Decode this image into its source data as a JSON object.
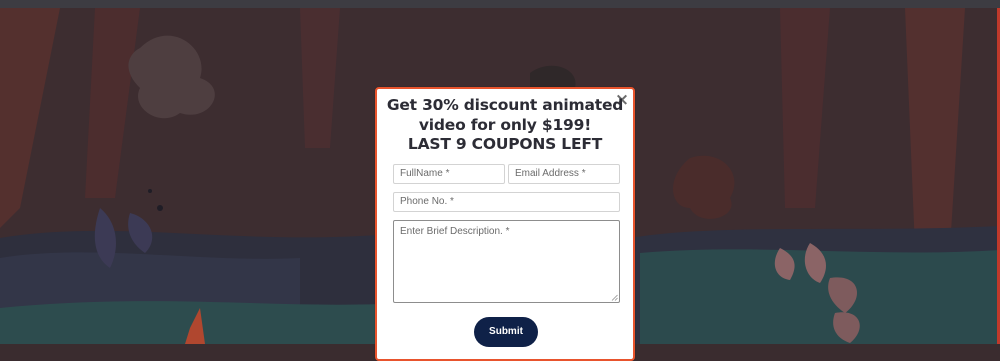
{
  "modal": {
    "close_glyph": "×",
    "heading_line1": "Get 30% discount animated",
    "heading_line2": "video for only $199!",
    "heading_line3": "LAST 9 COUPONS LEFT",
    "submit_label": "Submit"
  },
  "form": {
    "fullname_placeholder": "FullName *",
    "email_placeholder": "Email Address *",
    "phone_placeholder": "Phone No. *",
    "description_placeholder": "Enter Brief Description. *"
  },
  "colors": {
    "modal_border": "#e8542d",
    "submit_bg": "#0f2148",
    "overlay_tint": "#3a2c2f"
  }
}
